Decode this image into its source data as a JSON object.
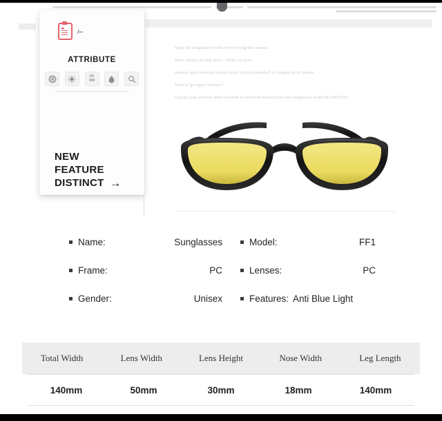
{
  "chrome": {
    "badge_icon": "pin-badge-icon"
  },
  "card": {
    "brand_icon": "clipboard-icon",
    "brand_scribble": "/---",
    "title": "ATTRIBUTE",
    "icons": [
      {
        "name": "spiral-lens-icon",
        "label": ""
      },
      {
        "name": "sun-protection-icon",
        "label": ""
      },
      {
        "name": "uv400-icon",
        "label_top": "UV",
        "label_bottom": "400"
      },
      {
        "name": "water-drop-icon",
        "label": ""
      },
      {
        "name": "magnifier-icon",
        "label": ""
      }
    ],
    "headline_line1": "NEW",
    "headline_line2": "FEATURE",
    "headline_line3": "DISTINCT",
    "headline_arrow": "→"
  },
  "copy": {
    "lines": [
      "Shop the sunglasses trends we're loving this season.",
      "Retro shapes are big news - think cat-eyes,",
      "aviators and oversized round styles with tortoiseshell or leopard print frames.",
      "Want to go super 'fashion'?",
      "Update your aviators with coloured or mirrored lenses from cool sunglasses brand MADELINY."
    ]
  },
  "product": {
    "image_name": "sunglasses-product-photo",
    "frame_color": "#1a1a1a",
    "lens_color": "#efe06a"
  },
  "specs": {
    "rows": [
      {
        "left": {
          "label": "Name:",
          "value": "Sunglasses"
        },
        "right": {
          "label": "Model:",
          "value": "FF1"
        }
      },
      {
        "left": {
          "label": "Frame:",
          "value": "PC"
        },
        "right": {
          "label": "Lenses:",
          "value": "PC"
        }
      },
      {
        "left": {
          "label": "Gender:",
          "value": "Unisex"
        },
        "right": {
          "label": "Features:",
          "value": "Anti Blue Light"
        }
      }
    ]
  },
  "measurements": {
    "headers": [
      "Total Width",
      "Lens Width",
      "Lens Height",
      "Nose Width",
      "Leg Length"
    ],
    "values": [
      "140mm",
      "50mm",
      "30mm",
      "18mm",
      "140mm"
    ]
  }
}
